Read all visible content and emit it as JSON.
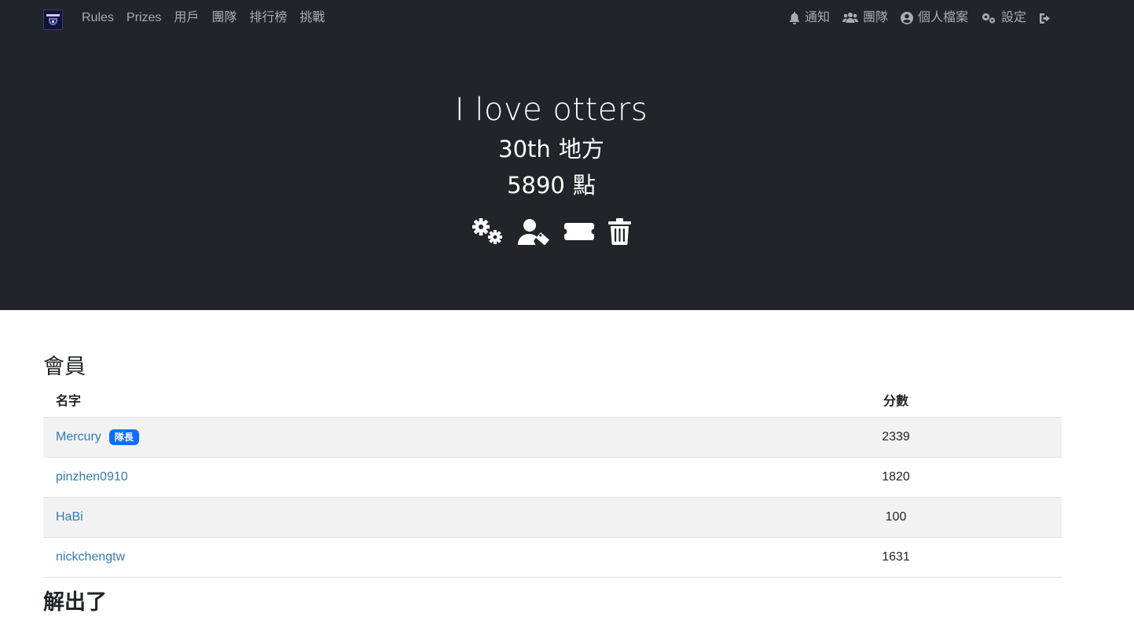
{
  "nav": {
    "left_links": [
      "Rules",
      "Prizes",
      "用戶",
      "團隊",
      "排行榜",
      "挑戰"
    ],
    "right_links": [
      {
        "icon": "bell-icon",
        "label": "通知"
      },
      {
        "icon": "users-icon",
        "label": "團隊"
      },
      {
        "icon": "user-circle-icon",
        "label": "個人檔案"
      },
      {
        "icon": "cogs-icon",
        "label": "設定"
      },
      {
        "icon": "sign-out-icon",
        "label": ""
      }
    ]
  },
  "team": {
    "name": "I love otters",
    "place": "30th",
    "place_suffix": "地方",
    "points": "5890",
    "points_suffix": "點",
    "actions": [
      "cogs-icon",
      "user-tag-icon",
      "ticket-icon",
      "trash-icon"
    ]
  },
  "members": {
    "title": "會員",
    "header": {
      "name": "名字",
      "score": "分數"
    },
    "rows": [
      {
        "name": "Mercury",
        "badge": "隊長",
        "score": "2339"
      },
      {
        "name": "pinzhen0910",
        "badge": "",
        "score": "1820"
      },
      {
        "name": "HaBi",
        "badge": "",
        "score": "100"
      },
      {
        "name": "nickchengtw",
        "badge": "",
        "score": "1631"
      }
    ]
  },
  "solves": {
    "title": "解出了"
  },
  "colors": {
    "jumbotron_bg": "#212529",
    "link": "#337ab7",
    "badge": "#0d6efd",
    "stripe": "#f2f2f2"
  }
}
